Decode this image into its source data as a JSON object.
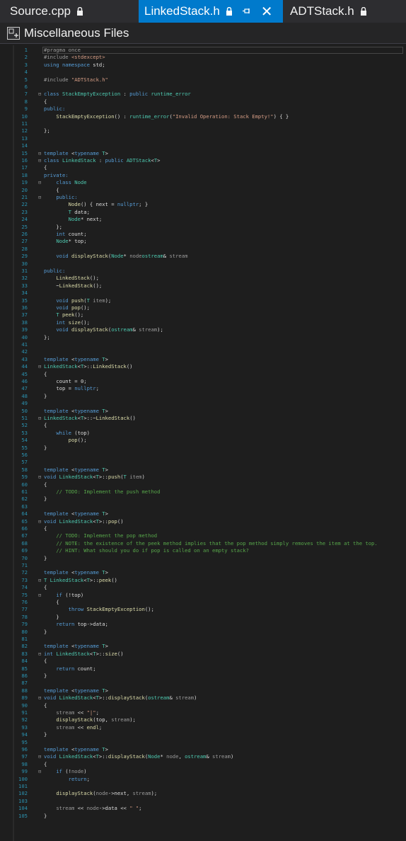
{
  "tabs": [
    {
      "label": "Source.cpp",
      "active": false
    },
    {
      "label": "LinkedStack.h",
      "active": true
    },
    {
      "label": "ADTStack.h",
      "active": false
    }
  ],
  "file_bar": {
    "title": "Miscellaneous Files"
  },
  "lines": [
    [
      [
        "pp",
        "#pragma once"
      ]
    ],
    [
      [
        "pp",
        "#include "
      ],
      [
        "st",
        "<stdexcept>"
      ]
    ],
    [
      [
        "kw",
        "using namespace "
      ],
      [
        "",
        "std;"
      ]
    ],
    [],
    [
      [
        "pp",
        "#include "
      ],
      [
        "st",
        "\"ADTStack.h\""
      ]
    ],
    [],
    [
      [
        "kw",
        "class "
      ],
      [
        "ty",
        "StackEmptyException"
      ],
      [
        "",
        " : "
      ],
      [
        "kw",
        "public "
      ],
      [
        "ty",
        "runtime_error"
      ]
    ],
    [
      [
        "",
        "{"
      ]
    ],
    [
      [
        "kw",
        "public:"
      ]
    ],
    [
      [
        "",
        "    "
      ],
      [
        "fn",
        "StackEmptyException"
      ],
      [
        "",
        "() : "
      ],
      [
        "ty",
        "runtime_error"
      ],
      [
        "",
        "("
      ],
      [
        "st",
        "\"Invalid Operation: Stack Empty!\""
      ],
      [
        "",
        ") { }"
      ]
    ],
    [],
    [
      [
        "",
        "};"
      ]
    ],
    [],
    [],
    [
      [
        "kw",
        "template "
      ],
      [
        "",
        "<"
      ],
      [
        "kw",
        "typename "
      ],
      [
        "ty",
        "T"
      ],
      [
        "",
        ">"
      ]
    ],
    [
      [
        "kw",
        "class "
      ],
      [
        "ty",
        "LinkedStack"
      ],
      [
        "",
        " : "
      ],
      [
        "kw",
        "public "
      ],
      [
        "ty",
        "ADTStack"
      ],
      [
        "",
        "<"
      ],
      [
        "ty",
        "T"
      ],
      [
        "",
        ">"
      ]
    ],
    [
      [
        "",
        "{"
      ]
    ],
    [
      [
        "kw",
        "private:"
      ]
    ],
    [
      [
        "",
        "    "
      ],
      [
        "kw",
        "class "
      ],
      [
        "ty",
        "Node"
      ]
    ],
    [
      [
        "",
        "    {"
      ]
    ],
    [
      [
        "",
        "    "
      ],
      [
        "kw",
        "public:"
      ]
    ],
    [
      [
        "",
        "        "
      ],
      [
        "fn",
        "Node"
      ],
      [
        "",
        "() { next = "
      ],
      [
        "kw",
        "nullptr"
      ],
      [
        "",
        "; }"
      ]
    ],
    [
      [
        "",
        "        "
      ],
      [
        "ty",
        "T"
      ],
      [
        "",
        " data;"
      ]
    ],
    [
      [
        "",
        "        "
      ],
      [
        "ty",
        "Node"
      ],
      [
        "",
        "* next;"
      ]
    ],
    [
      [
        "",
        "    };"
      ]
    ],
    [
      [
        "",
        "    "
      ],
      [
        "kw",
        "int "
      ],
      [
        "",
        "count;"
      ]
    ],
    [
      [
        "",
        "    "
      ],
      [
        "ty",
        "Node"
      ],
      [
        "",
        "* top;"
      ]
    ],
    [],
    [
      [
        "",
        "    "
      ],
      [
        "kw",
        "void "
      ],
      [
        "fn",
        "displayStack"
      ],
      [
        "",
        "("
      ],
      [
        "ty",
        "Node"
      ],
      [
        "",
        "* "
      ],
      [
        "pr",
        "node"
      ],
      [
        ", "
      ],
      [
        "ty",
        "ostream"
      ],
      [
        "",
        "& "
      ],
      [
        "pr",
        "stream"
      ],
      [
        ");"
      ]
    ],
    [],
    [
      [
        "kw",
        "public:"
      ]
    ],
    [
      [
        "",
        "    "
      ],
      [
        "fn",
        "LinkedStack"
      ],
      [
        "",
        "();"
      ]
    ],
    [
      [
        "",
        "    ~"
      ],
      [
        "fn",
        "LinkedStack"
      ],
      [
        "",
        "();"
      ]
    ],
    [],
    [
      [
        "",
        "    "
      ],
      [
        "kw",
        "void "
      ],
      [
        "fn",
        "push"
      ],
      [
        "",
        "("
      ],
      [
        "ty",
        "T "
      ],
      [
        "pr",
        "item"
      ],
      [
        "",
        ");"
      ]
    ],
    [
      [
        "",
        "    "
      ],
      [
        "kw",
        "void "
      ],
      [
        "fn",
        "pop"
      ],
      [
        "",
        "();"
      ]
    ],
    [
      [
        "",
        "    "
      ],
      [
        "ty",
        "T "
      ],
      [
        "fn",
        "peek"
      ],
      [
        "",
        "();"
      ]
    ],
    [
      [
        "",
        "    "
      ],
      [
        "kw",
        "int "
      ],
      [
        "fn",
        "size"
      ],
      [
        "",
        "();"
      ]
    ],
    [
      [
        "",
        "    "
      ],
      [
        "kw",
        "void "
      ],
      [
        "fn",
        "displayStack"
      ],
      [
        "",
        "("
      ],
      [
        "ty",
        "ostream"
      ],
      [
        "",
        "& "
      ],
      [
        "pr",
        "stream"
      ],
      [
        "",
        ");"
      ]
    ],
    [
      [
        "",
        "};"
      ]
    ],
    [],
    [],
    [
      [
        "kw",
        "template "
      ],
      [
        "",
        "<"
      ],
      [
        "kw",
        "typename "
      ],
      [
        "ty",
        "T"
      ],
      [
        "",
        ">"
      ]
    ],
    [
      [
        "ty",
        "LinkedStack"
      ],
      [
        "",
        "<"
      ],
      [
        "ty",
        "T"
      ],
      [
        "",
        ">::"
      ],
      [
        "fn",
        "LinkedStack"
      ],
      [
        "",
        "()"
      ]
    ],
    [
      [
        "",
        "{"
      ]
    ],
    [
      [
        "",
        "    "
      ],
      [
        "mb",
        "count"
      ],
      [
        "",
        " = "
      ],
      [
        "",
        "0;"
      ]
    ],
    [
      [
        "",
        "    "
      ],
      [
        "mb",
        "top"
      ],
      [
        "",
        " = "
      ],
      [
        "kw",
        "nullptr"
      ],
      [
        "",
        ";"
      ]
    ],
    [
      [
        "",
        "}"
      ]
    ],
    [],
    [
      [
        "kw",
        "template "
      ],
      [
        "",
        "<"
      ],
      [
        "kw",
        "typename "
      ],
      [
        "ty",
        "T"
      ],
      [
        "",
        ">"
      ]
    ],
    [
      [
        "ty",
        "LinkedStack"
      ],
      [
        "",
        "<"
      ],
      [
        "ty",
        "T"
      ],
      [
        "",
        ">::~"
      ],
      [
        "fn",
        "LinkedStack"
      ],
      [
        "",
        "()"
      ]
    ],
    [
      [
        "",
        "{"
      ]
    ],
    [
      [
        "",
        "    "
      ],
      [
        "kw",
        "while "
      ],
      [
        "",
        "(top)"
      ]
    ],
    [
      [
        "",
        "        "
      ],
      [
        "fn",
        "pop"
      ],
      [
        "",
        "();"
      ]
    ],
    [
      [
        "",
        "}"
      ]
    ],
    [],
    [],
    [
      [
        "kw",
        "template "
      ],
      [
        "",
        "<"
      ],
      [
        "kw",
        "typename "
      ],
      [
        "ty",
        "T"
      ],
      [
        "",
        ">"
      ]
    ],
    [
      [
        "kw",
        "void "
      ],
      [
        "ty",
        "LinkedStack"
      ],
      [
        "",
        "<"
      ],
      [
        "ty",
        "T"
      ],
      [
        "",
        ">::"
      ],
      [
        "fn",
        "push"
      ],
      [
        "",
        "("
      ],
      [
        "ty",
        "T "
      ],
      [
        "pr",
        "item"
      ],
      [
        "",
        ")"
      ]
    ],
    [
      [
        "",
        "{"
      ]
    ],
    [
      [
        "",
        "    "
      ],
      [
        "cm",
        "// TODO: Implement the push method"
      ]
    ],
    [
      [
        "",
        "}"
      ]
    ],
    [],
    [
      [
        "kw",
        "template "
      ],
      [
        "",
        "<"
      ],
      [
        "kw",
        "typename "
      ],
      [
        "ty",
        "T"
      ],
      [
        "",
        ">"
      ]
    ],
    [
      [
        "kw",
        "void "
      ],
      [
        "ty",
        "LinkedStack"
      ],
      [
        "",
        "<"
      ],
      [
        "ty",
        "T"
      ],
      [
        "",
        ">::"
      ],
      [
        "fn",
        "pop"
      ],
      [
        "",
        "()"
      ]
    ],
    [
      [
        "",
        "{"
      ]
    ],
    [
      [
        "",
        "    "
      ],
      [
        "cm",
        "// TODO: Implement the pop method"
      ]
    ],
    [
      [
        "",
        "    "
      ],
      [
        "cm",
        "// NOTE: the existence of the peek method implies that the pop method simply removes the item at the top."
      ]
    ],
    [
      [
        "",
        "    "
      ],
      [
        "cm",
        "// HINT: What should you do if pop is called on an empty stack?"
      ]
    ],
    [
      [
        "",
        "}"
      ]
    ],
    [],
    [
      [
        "kw",
        "template "
      ],
      [
        "",
        "<"
      ],
      [
        "kw",
        "typename "
      ],
      [
        "ty",
        "T"
      ],
      [
        "",
        ">"
      ]
    ],
    [
      [
        "ty",
        "T "
      ],
      [
        "ty",
        "LinkedStack"
      ],
      [
        "",
        "<"
      ],
      [
        "ty",
        "T"
      ],
      [
        "",
        ">::"
      ],
      [
        "fn",
        "peek"
      ],
      [
        "",
        "()"
      ]
    ],
    [
      [
        "",
        "{"
      ]
    ],
    [
      [
        "",
        "    "
      ],
      [
        "kw",
        "if "
      ],
      [
        "",
        "(!top)"
      ]
    ],
    [
      [
        "",
        "    {"
      ]
    ],
    [
      [
        "",
        "        "
      ],
      [
        "kw",
        "throw "
      ],
      [
        "fn",
        "StackEmptyException"
      ],
      [
        "",
        "();"
      ]
    ],
    [
      [
        "",
        "    }"
      ]
    ],
    [
      [
        "",
        "    "
      ],
      [
        "kw",
        "return "
      ],
      [
        "",
        "top->data;"
      ]
    ],
    [
      [
        "",
        "}"
      ]
    ],
    [],
    [
      [
        "kw",
        "template "
      ],
      [
        "",
        "<"
      ],
      [
        "kw",
        "typename "
      ],
      [
        "ty",
        "T"
      ],
      [
        "",
        ">"
      ]
    ],
    [
      [
        "kw",
        "int "
      ],
      [
        "ty",
        "LinkedStack"
      ],
      [
        "",
        "<"
      ],
      [
        "ty",
        "T"
      ],
      [
        "",
        ">::"
      ],
      [
        "fn",
        "size"
      ],
      [
        "",
        "()"
      ]
    ],
    [
      [
        "",
        "{"
      ]
    ],
    [
      [
        "",
        "    "
      ],
      [
        "kw",
        "return "
      ],
      [
        "",
        "count;"
      ]
    ],
    [
      [
        "",
        "}"
      ]
    ],
    [],
    [
      [
        "kw",
        "template "
      ],
      [
        "",
        "<"
      ],
      [
        "kw",
        "typename "
      ],
      [
        "ty",
        "T"
      ],
      [
        "",
        ">"
      ]
    ],
    [
      [
        "kw",
        "void "
      ],
      [
        "ty",
        "LinkedStack"
      ],
      [
        "",
        "<"
      ],
      [
        "ty",
        "T"
      ],
      [
        "",
        ">::"
      ],
      [
        "fn",
        "displayStack"
      ],
      [
        "",
        "("
      ],
      [
        "ty",
        "ostream"
      ],
      [
        "",
        "& "
      ],
      [
        "pr",
        "stream"
      ],
      [
        "",
        ")"
      ]
    ],
    [
      [
        "",
        "{"
      ]
    ],
    [
      [
        "",
        "    "
      ],
      [
        "pr",
        "stream"
      ],
      [
        "",
        " << "
      ],
      [
        "st",
        "\"|\""
      ],
      [
        "",
        ";"
      ]
    ],
    [
      [
        "",
        "    "
      ],
      [
        "fn",
        "displayStack"
      ],
      [
        "",
        "(top, "
      ],
      [
        "pr",
        "stream"
      ],
      [
        "",
        ");"
      ]
    ],
    [
      [
        "",
        "    "
      ],
      [
        "pr",
        "stream"
      ],
      [
        "",
        " << "
      ],
      [
        "fn",
        "endl"
      ],
      [
        "",
        ";"
      ]
    ],
    [
      [
        "",
        "}"
      ]
    ],
    [],
    [
      [
        "kw",
        "template "
      ],
      [
        "",
        "<"
      ],
      [
        "kw",
        "typename "
      ],
      [
        "ty",
        "T"
      ],
      [
        "",
        ">"
      ]
    ],
    [
      [
        "kw",
        "void "
      ],
      [
        "ty",
        "LinkedStack"
      ],
      [
        "",
        "<"
      ],
      [
        "ty",
        "T"
      ],
      [
        "",
        ">::"
      ],
      [
        "fn",
        "displayStack"
      ],
      [
        "",
        "("
      ],
      [
        "ty",
        "Node"
      ],
      [
        "",
        "* "
      ],
      [
        "pr",
        "node"
      ],
      [
        "",
        ", "
      ],
      [
        "ty",
        "ostream"
      ],
      [
        "",
        "& "
      ],
      [
        "pr",
        "stream"
      ],
      [
        "",
        ")"
      ]
    ],
    [
      [
        "",
        "{"
      ]
    ],
    [
      [
        "",
        "    "
      ],
      [
        "kw",
        "if "
      ],
      [
        "",
        "(!"
      ],
      [
        "pr",
        "node"
      ],
      [
        "",
        ")"
      ]
    ],
    [
      [
        "",
        "        "
      ],
      [
        "kw",
        "return"
      ],
      [
        "",
        ";"
      ]
    ],
    [],
    [
      [
        "",
        "    "
      ],
      [
        "fn",
        "displayStack"
      ],
      [
        "",
        "("
      ],
      [
        "pr",
        "node"
      ],
      [
        "",
        "->next, "
      ],
      [
        "pr",
        "stream"
      ],
      [
        "",
        ");"
      ]
    ],
    [],
    [
      [
        "",
        "    "
      ],
      [
        "pr",
        "stream"
      ],
      [
        "",
        " << "
      ],
      [
        "pr",
        "node"
      ],
      [
        "",
        "->data << "
      ],
      [
        "st",
        "\" \""
      ],
      [
        "",
        ";"
      ]
    ],
    [
      [
        "",
        "}"
      ]
    ]
  ],
  "fold_markers": {
    "7": "⊟",
    "15": "⊟",
    "16": "⊟",
    "19": "⊟",
    "21": "⊟",
    "44": "⊟",
    "51": "⊟",
    "59": "⊟",
    "65": "⊟",
    "73": "⊟",
    "75": "⊟",
    "83": "⊟",
    "89": "⊟",
    "97": "⊟",
    "99": "⊟"
  }
}
